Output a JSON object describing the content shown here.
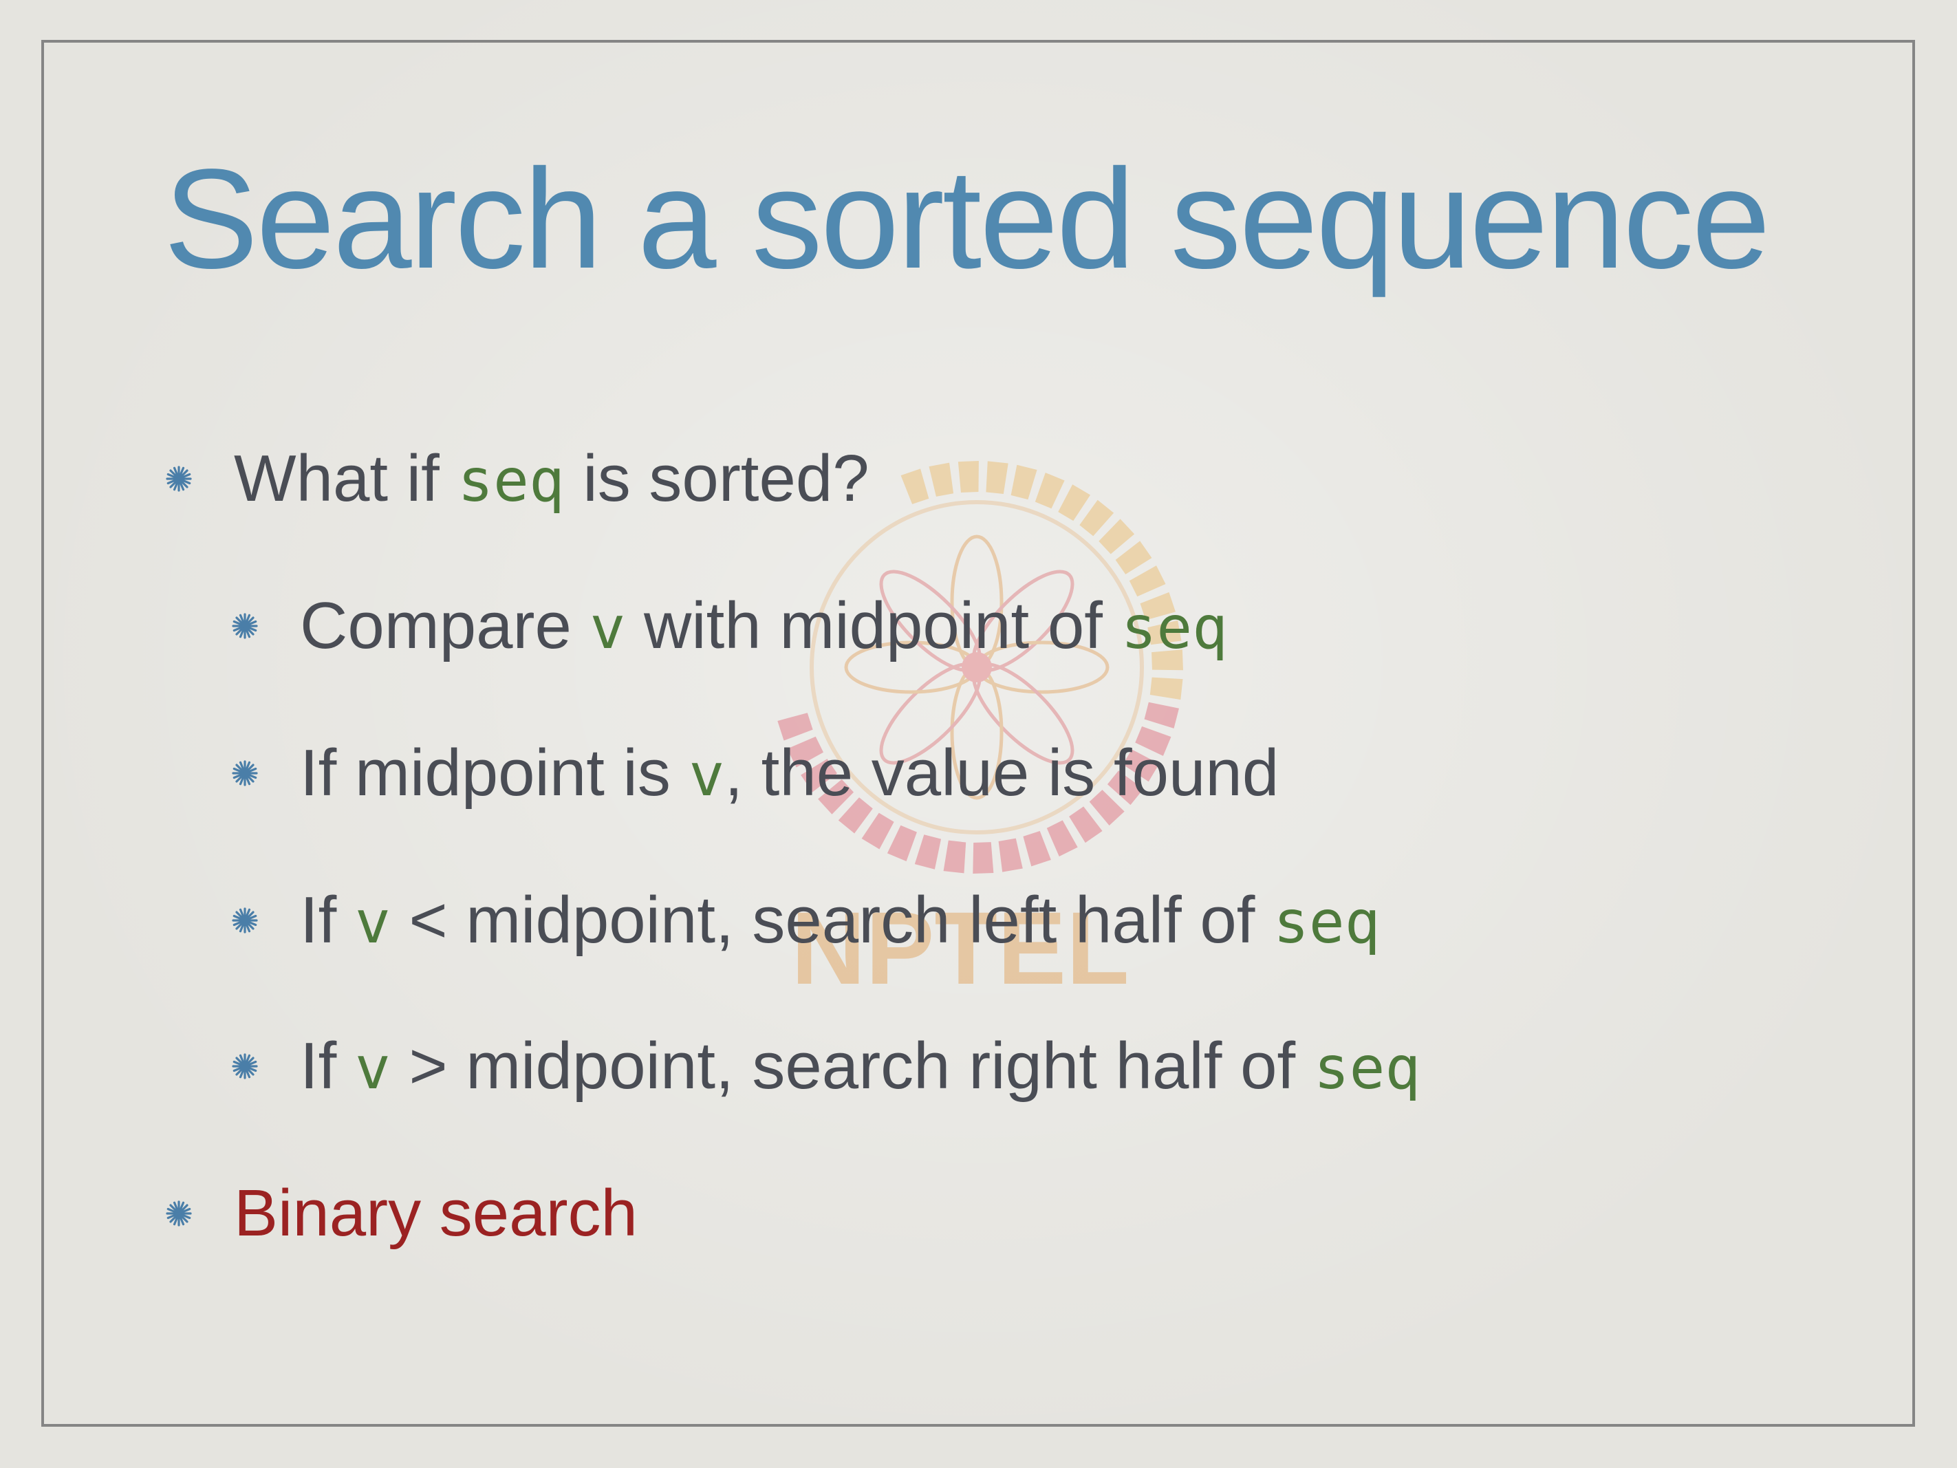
{
  "slide": {
    "title": "Search a sorted sequence",
    "watermark_text": "NPTEL",
    "colors": {
      "title": "#5189b0",
      "body_text": "#4a4d55",
      "code": "#4e7a3c",
      "highlight": "#9b2222",
      "bullet": "#4a7ea8",
      "frame": "#858585"
    },
    "bullets": [
      {
        "level": 1,
        "parts": [
          {
            "text": "What if ",
            "style": "text"
          },
          {
            "text": "seq",
            "style": "code"
          },
          {
            "text": " is sorted?",
            "style": "text"
          }
        ]
      },
      {
        "level": 2,
        "parts": [
          {
            "text": "Compare ",
            "style": "text"
          },
          {
            "text": "v",
            "style": "code"
          },
          {
            "text": " with midpoint of ",
            "style": "text"
          },
          {
            "text": "seq",
            "style": "code"
          }
        ]
      },
      {
        "level": 2,
        "parts": [
          {
            "text": "If midpoint is ",
            "style": "text"
          },
          {
            "text": "v",
            "style": "code"
          },
          {
            "text": ", the value is found",
            "style": "text"
          }
        ]
      },
      {
        "level": 2,
        "parts": [
          {
            "text": "If ",
            "style": "text"
          },
          {
            "text": "v",
            "style": "code"
          },
          {
            "text": " < midpoint, search left half of ",
            "style": "text"
          },
          {
            "text": "seq",
            "style": "code"
          }
        ]
      },
      {
        "level": 2,
        "parts": [
          {
            "text": "If ",
            "style": "text"
          },
          {
            "text": "v",
            "style": "code"
          },
          {
            "text": " > midpoint, search right half of ",
            "style": "text"
          },
          {
            "text": "seq",
            "style": "code"
          }
        ]
      },
      {
        "level": 1,
        "parts": [
          {
            "text": "Binary search",
            "style": "highlight"
          }
        ]
      }
    ]
  }
}
